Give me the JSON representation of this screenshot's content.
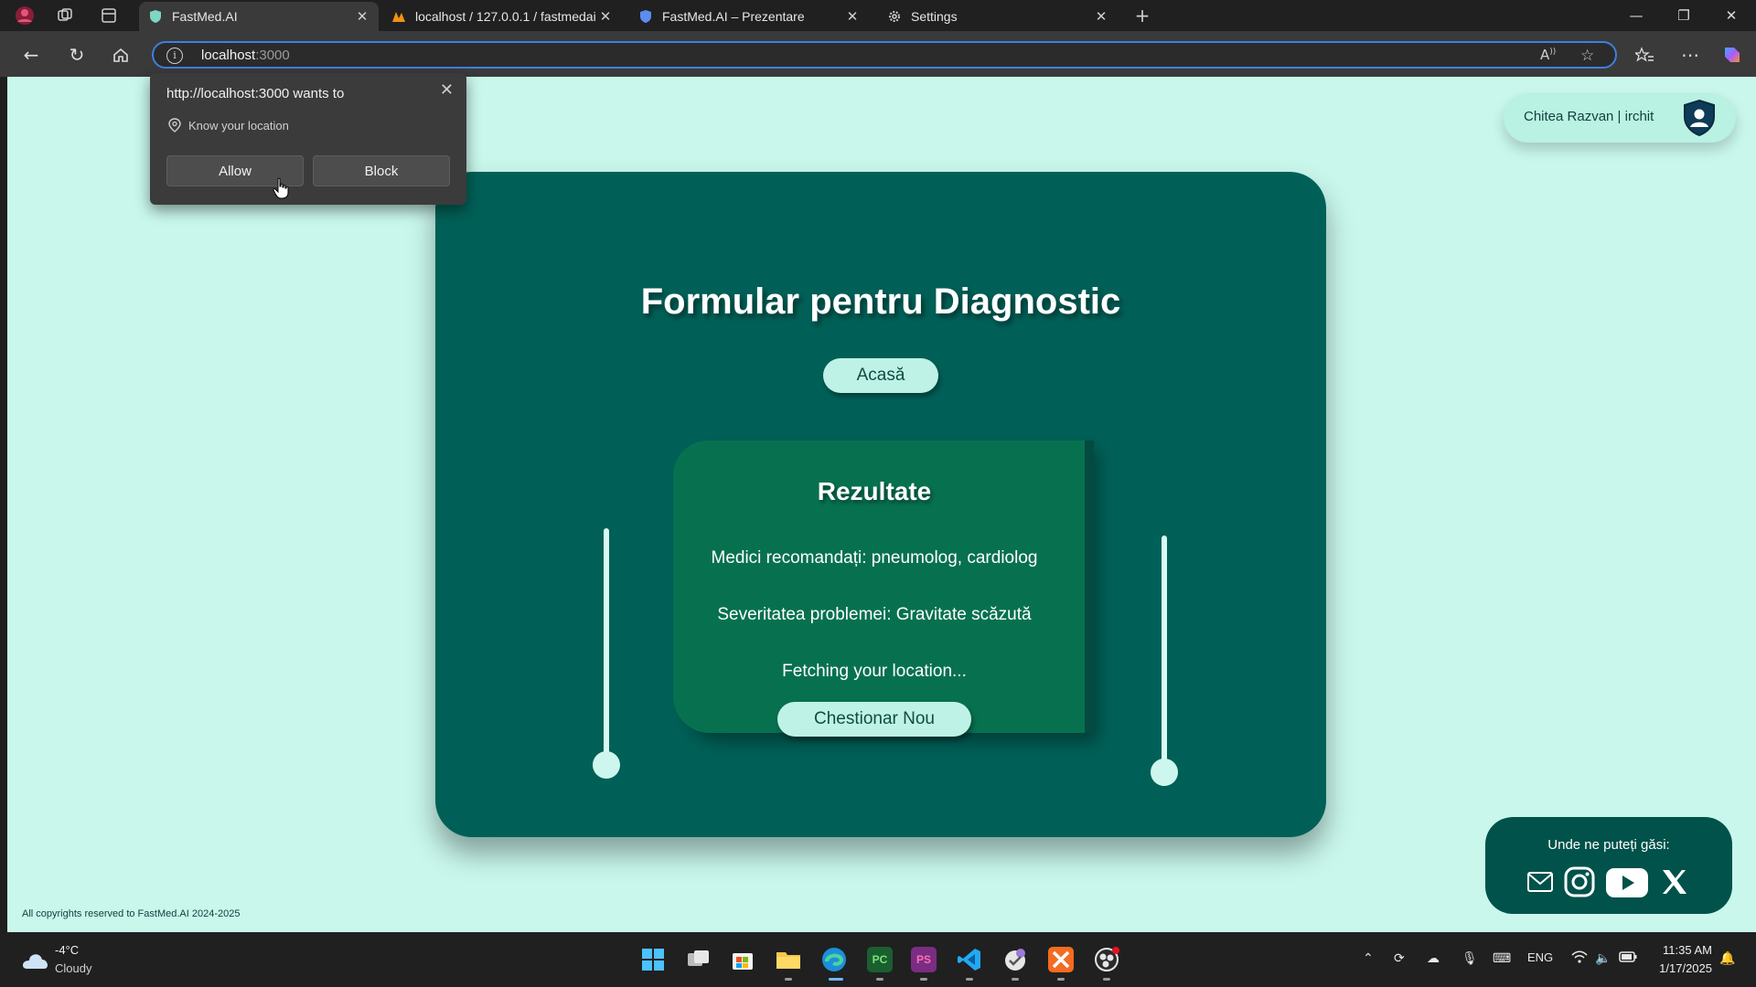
{
  "browser": {
    "tabs": [
      {
        "title": "FastMed.AI",
        "active": true,
        "icon": "shield-favicon"
      },
      {
        "title": "localhost / 127.0.0.1 / fastmedai / ",
        "active": false,
        "icon": "phpmyadmin-favicon"
      },
      {
        "title": "FastMed.AI – Prezentare",
        "active": false,
        "icon": "shield-favicon"
      },
      {
        "title": "Settings",
        "active": false,
        "icon": "gear-icon"
      }
    ],
    "url_host": "localhost",
    "url_port": ":3000",
    "new_tab_label": "+"
  },
  "permission_popup": {
    "title": "http://localhost:3000 wants to",
    "permission": "Know your location",
    "allow_label": "Allow",
    "block_label": "Block"
  },
  "page": {
    "title": "Formular pentru Diagnostic",
    "home_button": "Acasă",
    "results": {
      "title": "Rezultate",
      "doctors": "Medici recomandați: pneumolog, cardiolog",
      "severity": "Severitatea problemei: Gravitate scăzută",
      "location": "Fetching your location...",
      "new_quiz_button": "Chestionar Nou"
    },
    "user": {
      "name": "Chitea Razvan | irchit"
    },
    "social": {
      "title": "Unde ne puteți găsi:"
    },
    "copyright": "All copyrights reserved to FastMed.AI 2024-2025"
  },
  "colors": {
    "page_bg": "#c9f7ec",
    "card_bg": "#006057",
    "result_bg": "#07714f",
    "button_bg": "#bff2e6",
    "accent_blue": "#3f7fe0"
  },
  "taskbar": {
    "weather_temp": "-4°C",
    "weather_desc": "Cloudy",
    "language": "ENG",
    "time": "11:35 AM",
    "date": "1/17/2025"
  }
}
